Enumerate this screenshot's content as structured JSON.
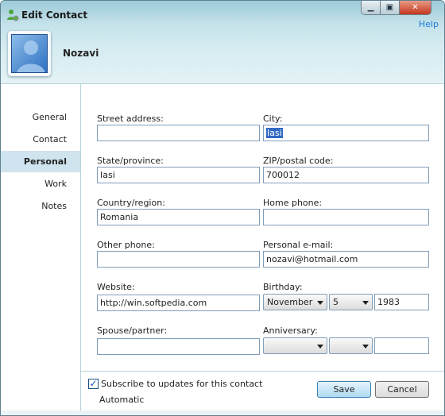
{
  "window": {
    "title": "Edit Contact",
    "help": "Help",
    "controls": [
      "minimize",
      "maximize",
      "close"
    ]
  },
  "contact": {
    "name": "Nozavi"
  },
  "nav": {
    "items": [
      {
        "label": "General"
      },
      {
        "label": "Contact"
      },
      {
        "label": "Personal",
        "selected": true
      },
      {
        "label": "Work"
      },
      {
        "label": "Notes"
      }
    ]
  },
  "form": {
    "street": {
      "label": "Street address:",
      "value": ""
    },
    "city": {
      "label": "City:",
      "value": "Iasi"
    },
    "state": {
      "label": "State/province:",
      "value": "Iasi"
    },
    "zip": {
      "label": "ZIP/postal code:",
      "value": "700012"
    },
    "country": {
      "label": "Country/region:",
      "value": "Romania"
    },
    "home_phone": {
      "label": "Home phone:",
      "value": ""
    },
    "other_phone": {
      "label": "Other phone:",
      "value": ""
    },
    "email": {
      "label": "Personal e-mail:",
      "value": "nozavi@hotmail.com"
    },
    "website": {
      "label": "Website:",
      "value": "http://win.softpedia.com"
    },
    "birthday": {
      "label": "Birthday:",
      "month": "November",
      "day": "5",
      "year": "1983"
    },
    "spouse": {
      "label": "Spouse/partner:",
      "value": ""
    },
    "anniversary": {
      "label": "Anniversary:",
      "month": "",
      "day": "",
      "year": ""
    }
  },
  "footer": {
    "subscribe_label": "Subscribe to updates for this contact",
    "subscribe_checked": true,
    "mode": "Automatic",
    "save": "Save",
    "cancel": "Cancel"
  }
}
